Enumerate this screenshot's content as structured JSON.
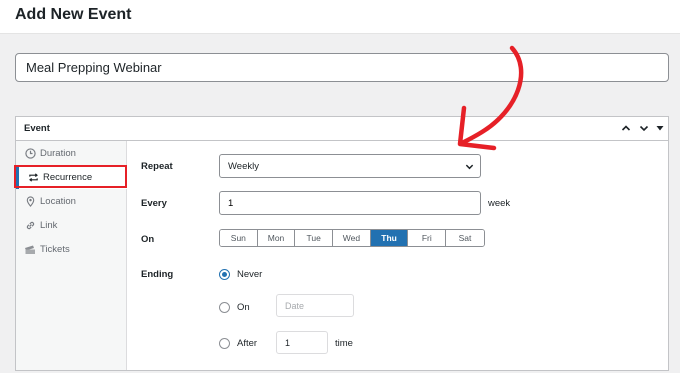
{
  "page": {
    "title": "Add New Event",
    "event_title_value": "Meal Prepping Webinar"
  },
  "metabox": {
    "title": "Event",
    "controls": [
      "chevron-up-icon",
      "chevron-down-icon",
      "triangle-down-icon"
    ]
  },
  "sidebar": {
    "items": [
      {
        "label": "Duration",
        "icon": "clock-icon"
      },
      {
        "label": "Recurrence",
        "icon": "repeat-icon",
        "active": true
      },
      {
        "label": "Location",
        "icon": "location-pin-icon"
      },
      {
        "label": "Link",
        "icon": "link-icon"
      },
      {
        "label": "Tickets",
        "icon": "tickets-icon"
      }
    ]
  },
  "recurrence": {
    "repeat_label": "Repeat",
    "repeat_value": "Weekly",
    "every_label": "Every",
    "every_value": "1",
    "every_unit": "week",
    "on_label": "On",
    "days": [
      {
        "label": "Sun",
        "selected": false
      },
      {
        "label": "Mon",
        "selected": false
      },
      {
        "label": "Tue",
        "selected": false
      },
      {
        "label": "Wed",
        "selected": false
      },
      {
        "label": "Thu",
        "selected": true
      },
      {
        "label": "Fri",
        "selected": false
      },
      {
        "label": "Sat",
        "selected": false
      }
    ],
    "ending_label": "Ending",
    "ending_options": {
      "never": "Never",
      "on": "On",
      "after": "After"
    },
    "ending_selected": "never",
    "date_placeholder": "Date",
    "after_value": "1",
    "after_unit": "time"
  },
  "colors": {
    "accent": "#2271b1",
    "annotation_red": "#e62027",
    "background": "#f0f0f1"
  }
}
